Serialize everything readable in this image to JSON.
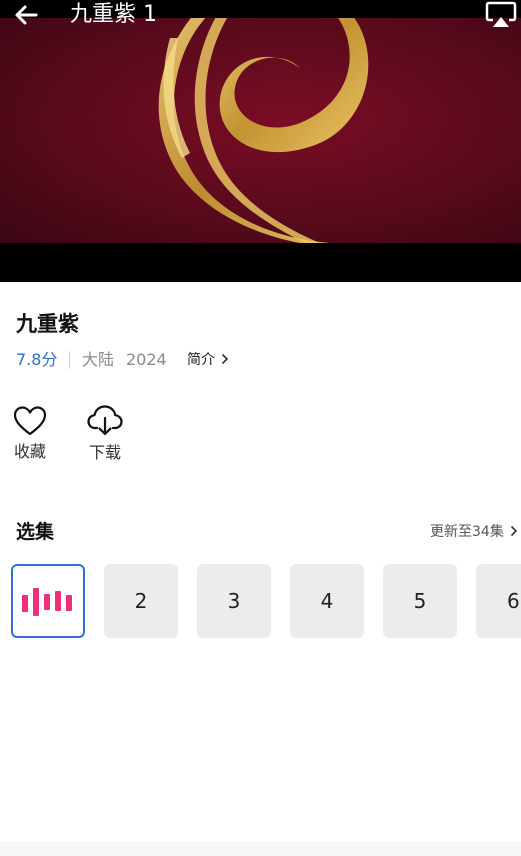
{
  "player": {
    "title": "九重紫 1",
    "back_icon": "arrow-left-icon",
    "cast_icon": "airplay-icon"
  },
  "show": {
    "title": "九重紫",
    "score": "7.8分",
    "region": "大陆",
    "year": "2024",
    "intro_label": "简介"
  },
  "actions": {
    "favorite_label": "收藏",
    "favorite_icon": "heart-icon",
    "download_label": "下载",
    "download_icon": "cloud-download-icon"
  },
  "episodes": {
    "title": "选集",
    "update_label": "更新至34集",
    "items": [
      "1",
      "2",
      "3",
      "4",
      "5",
      "6"
    ],
    "playing_icon": "equalizer-icon"
  },
  "colors": {
    "accent": "#2f6fd6",
    "playing": "#ef2e7d"
  }
}
